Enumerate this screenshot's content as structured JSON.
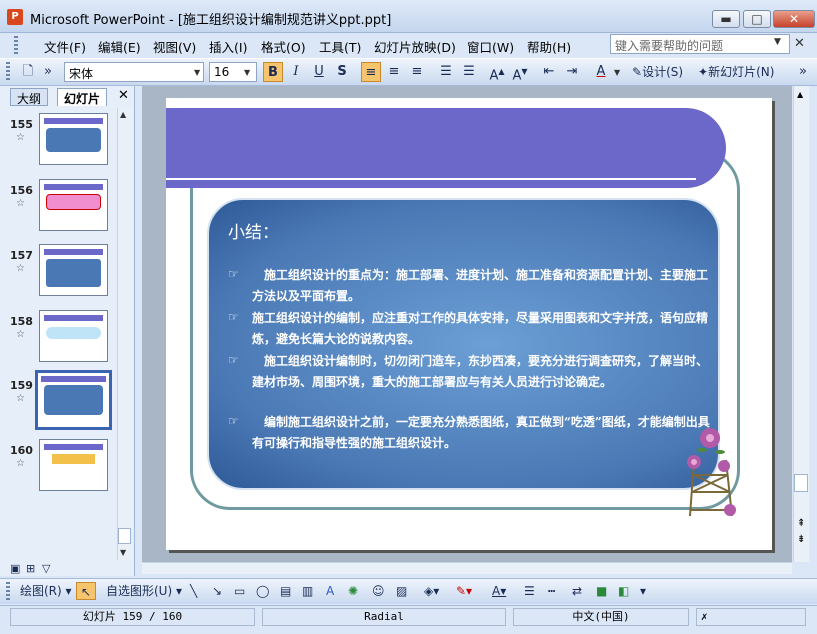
{
  "window": {
    "title": "Microsoft PowerPoint - [施工组织设计编制规范讲义ppt.ppt]",
    "app_icon": "P",
    "minimize": "▬",
    "maximize": "□",
    "close": "✕"
  },
  "menu": {
    "items": [
      "文件(F)",
      "编辑(E)",
      "视图(V)",
      "插入(I)",
      "格式(O)",
      "工具(T)",
      "幻灯片放映(D)",
      "窗口(W)",
      "帮助(H)"
    ],
    "help_placeholder": "键入需要帮助的问题"
  },
  "toolbar": {
    "font": "宋体",
    "size": "16",
    "bold": "B",
    "italic": "I",
    "underline": "U",
    "shadow": "S",
    "design": "设计(S)",
    "new_slide": "新幻灯片(N)"
  },
  "pane": {
    "tab_outline": "大纲",
    "tab_slides": "幻灯片",
    "close": "✕",
    "slides": [
      {
        "num": "155"
      },
      {
        "num": "156"
      },
      {
        "num": "157"
      },
      {
        "num": "158"
      },
      {
        "num": "159"
      },
      {
        "num": "160"
      }
    ]
  },
  "slide": {
    "heading": "小结：",
    "bullets": [
      "施工组织设计的重点为：施工部署、进度计划、施工准备和资源配置计划、主要施工方法以及平面布置。",
      "施工组织设计的编制，应注重对工作的具体安排，尽量采用图表和文字并茂，语句应精炼，避免长篇大论的说教内容。",
      "施工组织设计编制时，切勿闭门造车，东抄西凑，要充分进行调查研究，了解当时、建材市场、周围环境，重大的施工部署应与有关人员进行讨论确定。",
      "编制施工组织设计之前，一定要充分熟悉图纸，真正做到“吃透”图纸，才能编制出具有可操行和指导性强的施工组织设计。"
    ]
  },
  "drawbar": {
    "draw": "绘图(R)",
    "autoshapes": "自选图形(U)"
  },
  "status": {
    "slide_count": "幻灯片 159 / 160",
    "design": "Radial",
    "language": "中文(中国)"
  },
  "colors": {
    "header_band": "#6c68c9",
    "content_box": "#4a78b4",
    "frame": "#6f9aa0"
  }
}
